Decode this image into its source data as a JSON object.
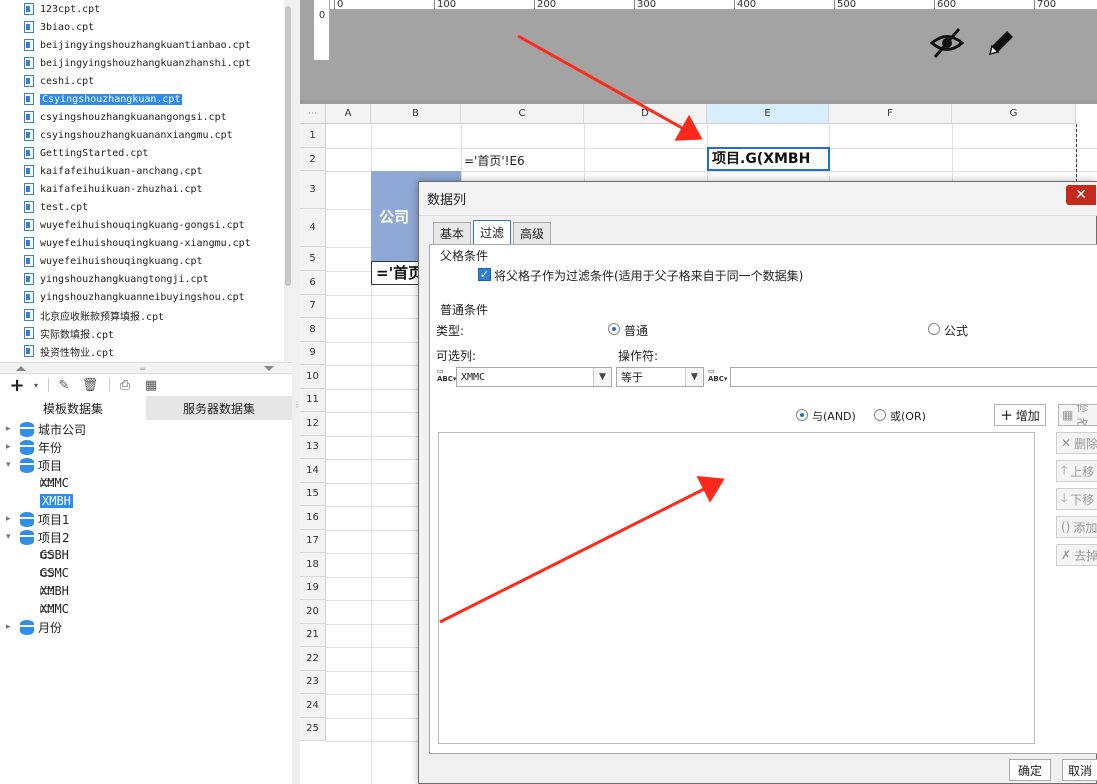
{
  "files": [
    "123cpt.cpt",
    "3biao.cpt",
    "beijingyingshouzhangkuantianbao.cpt",
    "beijingyingshouzhangkuanzhanshi.cpt",
    "ceshi.cpt",
    "Csyingshouzhangkuan.cpt",
    "csyingshouzhangkuanangongsi.cpt",
    "csyingshouzhangkuananxiangmu.cpt",
    "GettingStarted.cpt",
    "kaifafeihuikuan-anchang.cpt",
    "kaifafeihuikuan-zhuzhai.cpt",
    "test.cpt",
    "wuyefeihuishouqingkuang-gongsi.cpt",
    "wuyefeihuishouqingkuang-xiangmu.cpt",
    "wuyefeihuishouqingkuang.cpt",
    "yingshouzhangkuangtongji.cpt",
    "yingshouzhangkuanneibuyingshou.cpt",
    "北京应收账款预算填报.cpt",
    "实际数填报.cpt",
    "投资性物业.cpt"
  ],
  "selected_file_index": 5,
  "dataset_tabs": {
    "template": "模板数据集",
    "server": "服务器数据集"
  },
  "tree": {
    "n1": "城市公司",
    "n2": "年份",
    "n3": "项目",
    "n3f1": "XMMC",
    "n3f2": "XMBH",
    "n4": "项目1",
    "n5": "项目2",
    "n5f1": "GSBH",
    "n5f2": "GSMC",
    "n5f3": "XMBH",
    "n5f4": "XMMC",
    "n6": "月份"
  },
  "ruler": {
    "ticks": [
      "0",
      "100",
      "200",
      "300",
      "400",
      "500",
      "600",
      "700"
    ],
    "vlabel": "0"
  },
  "sheet": {
    "columns": [
      "A",
      "B",
      "C",
      "D",
      "E",
      "F",
      "G"
    ],
    "rows": [
      "1",
      "2",
      "3",
      "4",
      "5",
      "6",
      "7",
      "8",
      "9",
      "10",
      "11",
      "12",
      "13",
      "14",
      "15",
      "16",
      "17",
      "18",
      "19",
      "20",
      "21",
      "22",
      "23",
      "24",
      "25"
    ],
    "c2": "='首页'!E6",
    "e2": "项目.G(XMBH",
    "b3": "公司",
    "b5": "='首页"
  },
  "dialog": {
    "title": "数据列",
    "close": "✕",
    "tabs": [
      "基本",
      "过滤",
      "高级"
    ],
    "parent_group": "父格条件",
    "parent_check_label": "将父格子作为过滤条件(适用于父子格来自于同一个数据集)",
    "normal_group": "普通条件",
    "type_label": "类型:",
    "type_normal": "普通",
    "type_formula": "公式",
    "column_label": "可选列:",
    "operator_label": "操作符:",
    "column_value": "XMMC",
    "operator_value": "等于",
    "value_text": "",
    "and_label": "与(AND)",
    "or_label": "或(OR)",
    "add_button": "增加",
    "modify_button": "修改",
    "delete_button": "删除",
    "up_button": "上移",
    "down_button": "下移",
    "add_bracket_button": "添加括号",
    "remove_bracket_button": "去掉括号",
    "ok_button": "确定",
    "cancel_button": "取消"
  },
  "colors": {
    "selection": "#2d8cf0",
    "header_blue": "#8ea9d6",
    "arrow": "#ff2a1a"
  }
}
